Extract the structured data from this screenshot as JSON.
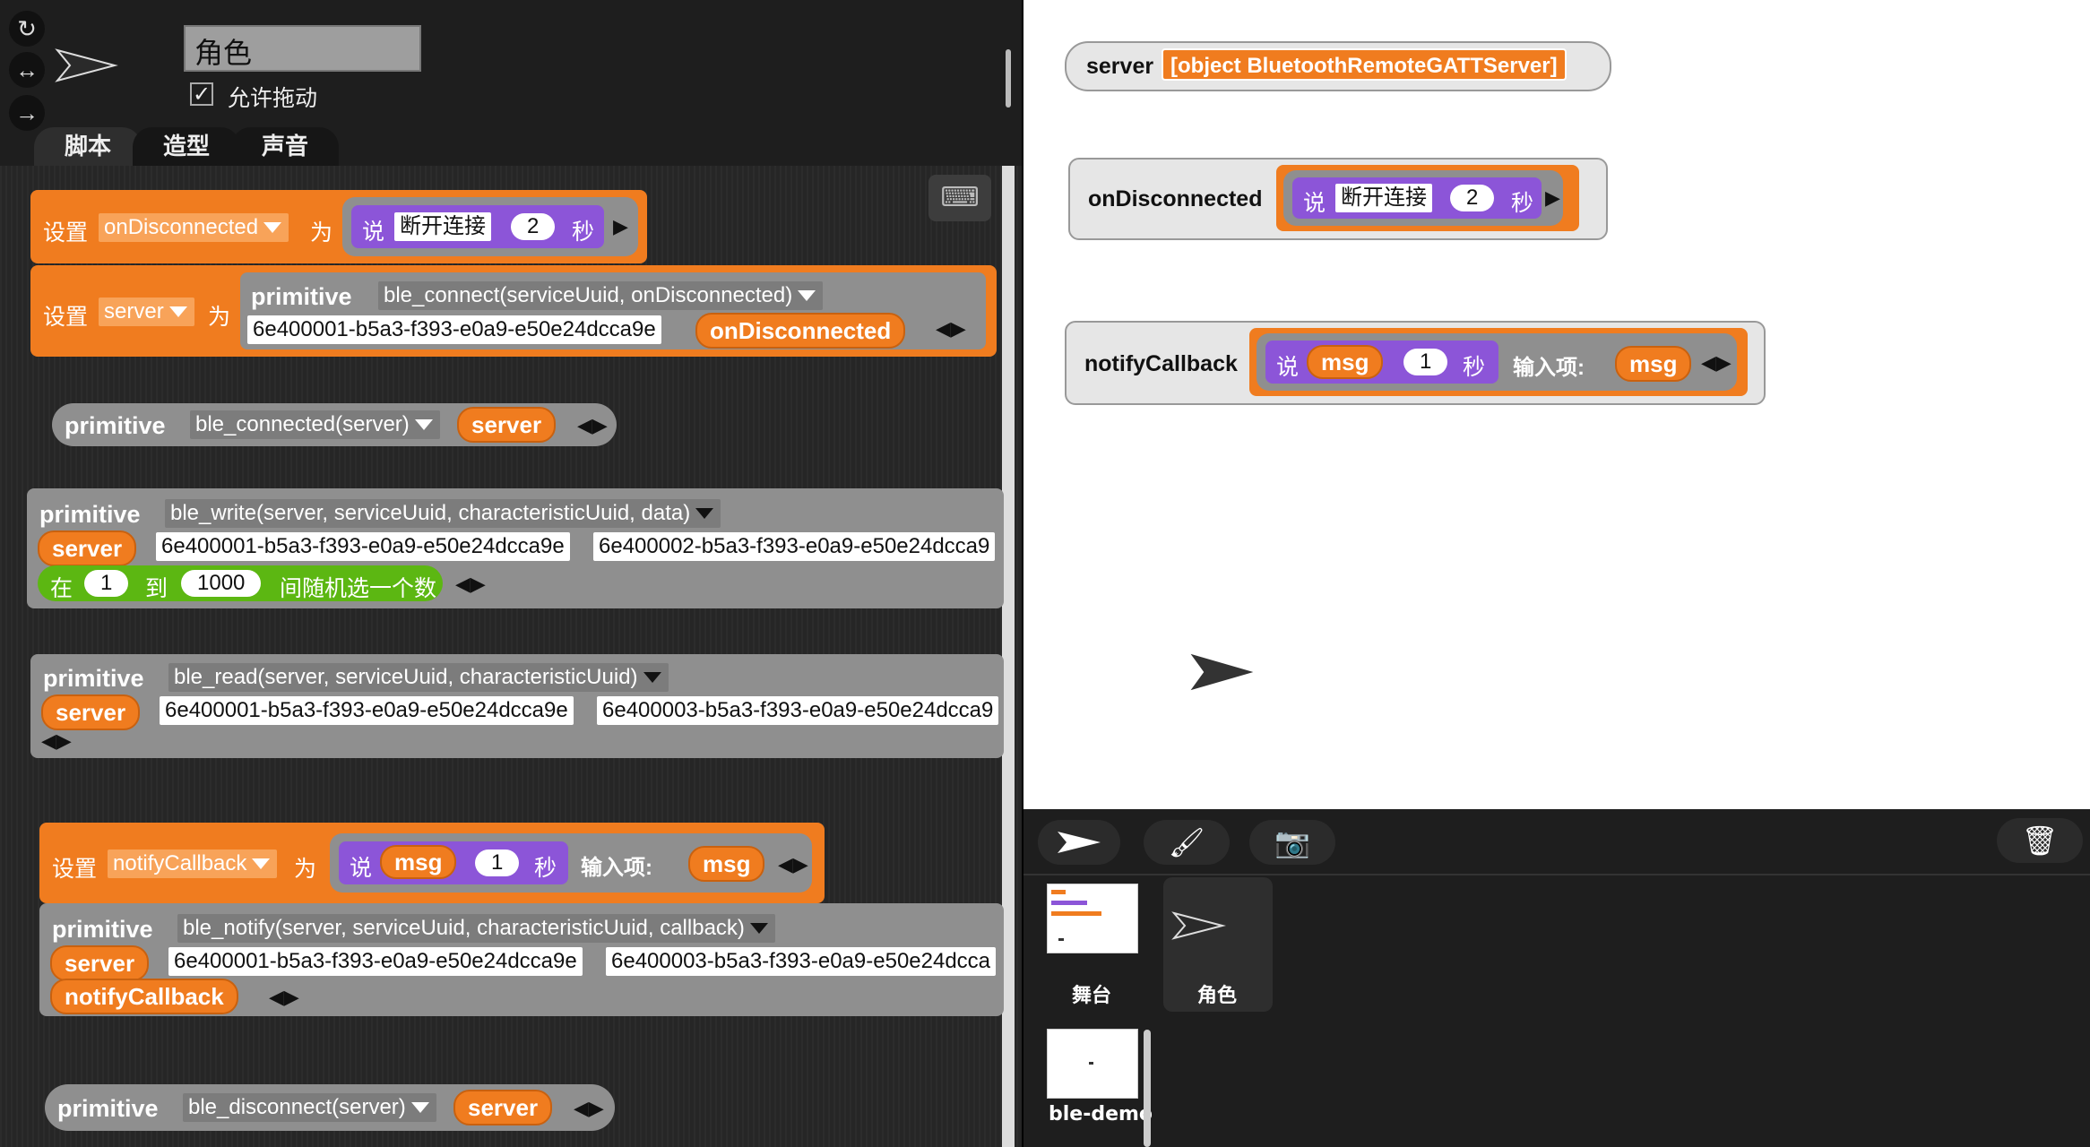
{
  "sprite": {
    "name": "角色",
    "draggable_label": "允许拖动",
    "draggable_checked": "✓",
    "icons": {
      "rotate_all": "rotate-icon",
      "flip": "flip-icon",
      "no_rotate": "no-rotate-icon"
    }
  },
  "tabs": [
    "脚本",
    "造型",
    "声音"
  ],
  "blocks": {
    "set_word": "设置",
    "to_word": "为",
    "say_word": "说",
    "secs_word": "秒",
    "primitive": "primitive",
    "input_word": "输入项:",
    "b1": {
      "var": "onDisconnected",
      "say_text": "断开连接",
      "secs": "2"
    },
    "b2": {
      "var": "server",
      "prim": "ble_connect(serviceUuid, onDisconnected)",
      "uuid": "6e400001-b5a3-f393-e0a9-e50e24dcca9e",
      "arg": "onDisconnected"
    },
    "b3": {
      "prim": "ble_connected(server)",
      "arg": "server"
    },
    "b4": {
      "prim": "ble_write(server, serviceUuid, characteristicUuid, data)",
      "arg": "server",
      "uuid1": "6e400001-b5a3-f393-e0a9-e50e24dcca9e",
      "uuid2": "6e400002-b5a3-f393-e0a9-e50e24dcca9",
      "rand_at": "在",
      "rand_from": "1",
      "rand_to_word": "到",
      "rand_to": "1000",
      "rand_tail": "间随机选一个数"
    },
    "b5": {
      "prim": "ble_read(server, serviceUuid, characteristicUuid)",
      "arg": "server",
      "uuid1": "6e400001-b5a3-f393-e0a9-e50e24dcca9e",
      "uuid2": "6e400003-b5a3-f393-e0a9-e50e24dcca9"
    },
    "b6": {
      "var": "notifyCallback",
      "say_arg": "msg",
      "secs": "1",
      "param": "msg"
    },
    "b7": {
      "prim": "ble_notify(server, serviceUuid, characteristicUuid, callback)",
      "arg": "server",
      "uuid1": "6e400001-b5a3-f393-e0a9-e50e24dcca9e",
      "uuid2": "6e400003-b5a3-f393-e0a9-e50e24dcca",
      "arg2": "notifyCallback"
    },
    "b8": {
      "prim": "ble_disconnect(server)",
      "arg": "server"
    }
  },
  "watchers": {
    "server": {
      "label": "server",
      "value": "[object BluetoothRemoteGATTServer]"
    },
    "ondisc": {
      "label": "onDisconnected",
      "say": "说",
      "text": "断开连接",
      "secs": "2",
      "secs_word": "秒"
    },
    "notify": {
      "label": "notifyCallback",
      "say": "说",
      "arg": "msg",
      "secs": "1",
      "secs_word": "秒",
      "input_word": "输入项:",
      "param": "msg"
    }
  },
  "corral": {
    "stage_label": "舞台",
    "sprite_label": "角色",
    "scene_label": "ble-demo",
    "buttons": [
      "turtle-icon",
      "paintbrush-icon",
      "camera-icon",
      "trash-icon"
    ]
  },
  "colors": {
    "orange": "#f07c1f",
    "gray": "#8f8f8f",
    "purple": "#8c55d8",
    "green": "#5cb712"
  }
}
